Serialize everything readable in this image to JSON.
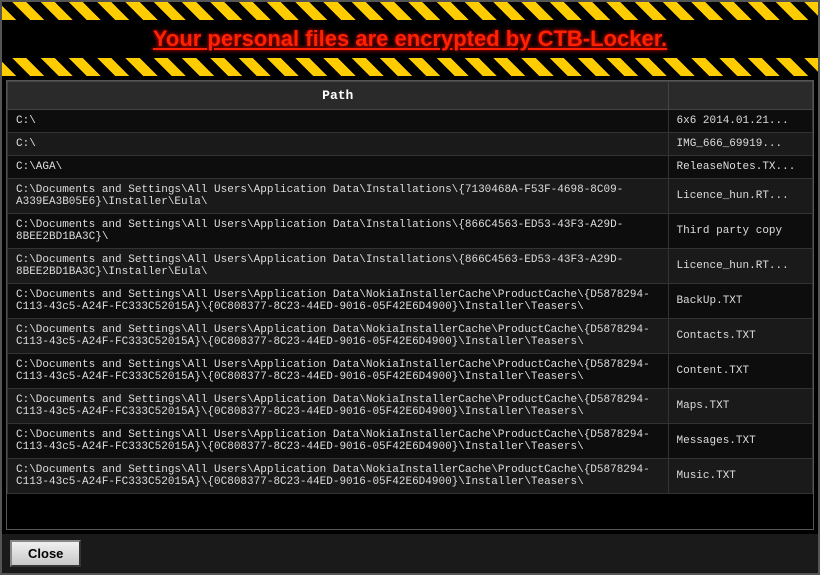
{
  "title": "Your personal files are encrypted by CTB-Locker.",
  "table": {
    "column_path": "Path",
    "column_file": "",
    "rows": [
      {
        "path": "C:\\",
        "file": "6x6 2014.01.21..."
      },
      {
        "path": "C:\\",
        "file": "IMG_666_69919..."
      },
      {
        "path": "C:\\AGA\\",
        "file": "ReleaseNotes.TX..."
      },
      {
        "path": "C:\\Documents and Settings\\All Users\\Application Data\\Installations\\{7130468A-F53F-4698-8C09-A339EA3B05E6}\\Installer\\Eula\\",
        "file": "Licence_hun.RT..."
      },
      {
        "path": "C:\\Documents and Settings\\All Users\\Application Data\\Installations\\{866C4563-ED53-43F3-A29D-8BEE2BD1BA3C}\\",
        "file": "Third party copy"
      },
      {
        "path": "C:\\Documents and Settings\\All Users\\Application Data\\Installations\\{866C4563-ED53-43F3-A29D-8BEE2BD1BA3C}\\Installer\\Eula\\",
        "file": "Licence_hun.RT..."
      },
      {
        "path": "C:\\Documents and Settings\\All Users\\Application Data\\NokiaInstallerCache\\ProductCache\\{D5878294-C113-43c5-A24F-FC333C52015A}\\{0C808377-8C23-44ED-9016-05F42E6D4900}\\Installer\\Teasers\\",
        "file": "BackUp.TXT"
      },
      {
        "path": "C:\\Documents and Settings\\All Users\\Application Data\\NokiaInstallerCache\\ProductCache\\{D5878294-C113-43c5-A24F-FC333C52015A}\\{0C808377-8C23-44ED-9016-05F42E6D4900}\\Installer\\Teasers\\",
        "file": "Contacts.TXT"
      },
      {
        "path": "C:\\Documents and Settings\\All Users\\Application Data\\NokiaInstallerCache\\ProductCache\\{D5878294-C113-43c5-A24F-FC333C52015A}\\{0C808377-8C23-44ED-9016-05F42E6D4900}\\Installer\\Teasers\\",
        "file": "Content.TXT"
      },
      {
        "path": "C:\\Documents and Settings\\All Users\\Application Data\\NokiaInstallerCache\\ProductCache\\{D5878294-C113-43c5-A24F-FC333C52015A}\\{0C808377-8C23-44ED-9016-05F42E6D4900}\\Installer\\Teasers\\",
        "file": "Maps.TXT"
      },
      {
        "path": "C:\\Documents and Settings\\All Users\\Application Data\\NokiaInstallerCache\\ProductCache\\{D5878294-C113-43c5-A24F-FC333C52015A}\\{0C808377-8C23-44ED-9016-05F42E6D4900}\\Installer\\Teasers\\",
        "file": "Messages.TXT"
      },
      {
        "path": "C:\\Documents and Settings\\All Users\\Application Data\\NokiaInstallerCache\\ProductCache\\{D5878294-C113-43c5-A24F-FC333C52015A}\\{0C808377-8C23-44ED-9016-05F42E6D4900}\\Installer\\Teasers\\",
        "file": "Music.TXT"
      }
    ]
  },
  "close_button_label": "Close"
}
